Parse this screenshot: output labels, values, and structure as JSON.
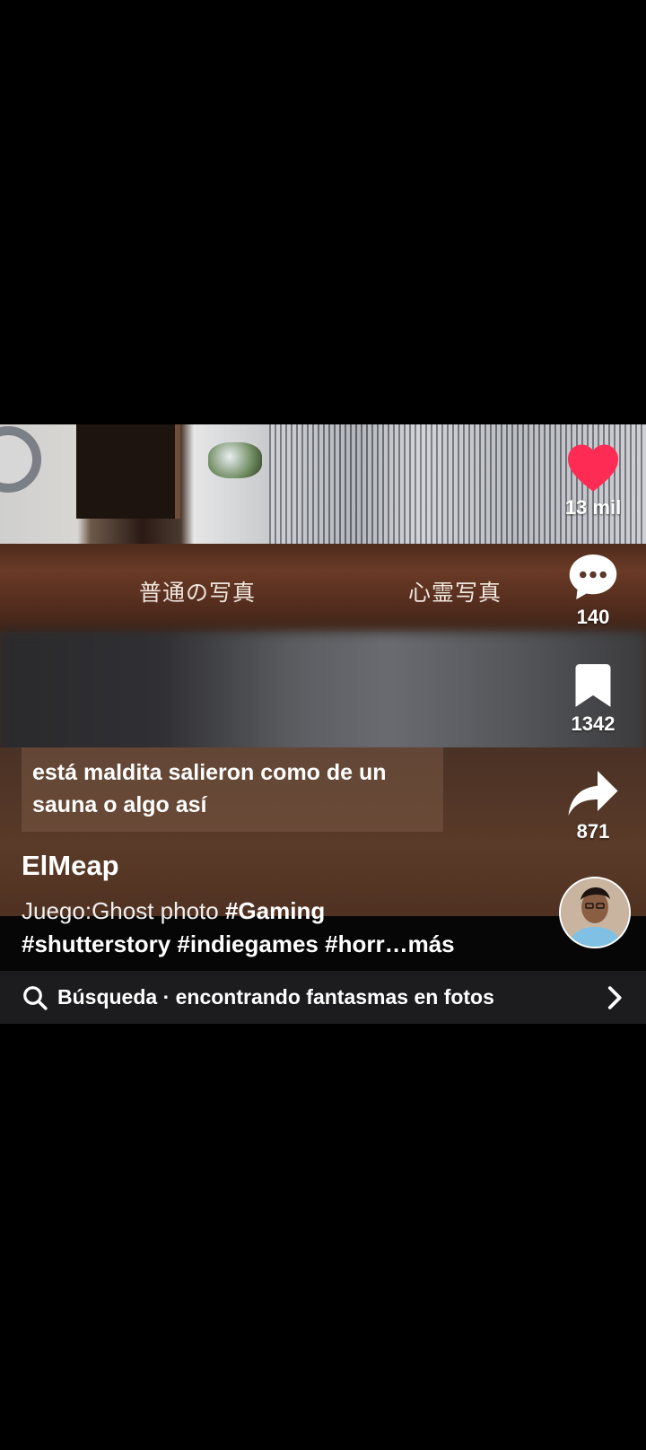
{
  "video": {
    "label_left": "普通の写真",
    "label_right": "心霊写真"
  },
  "caption": {
    "line1": "está maldita salieron como de un",
    "line2": "sauna o algo así"
  },
  "actions": {
    "likes": "13 mil",
    "comments": "140",
    "saves": "1342",
    "shares": "871",
    "like_color": "#fe2c55"
  },
  "post": {
    "username": "ElMeap",
    "desc_prefix": "Juego:Ghost photo ",
    "tag_gaming": "#Gaming",
    "desc_line2": "#shutterstory #indiegames #horr…",
    "more": "más"
  },
  "search": {
    "label": "Búsqueda · encontrando fantasmas en fotos"
  },
  "icons": [
    "heart-icon",
    "comment-icon",
    "bookmark-icon",
    "share-icon",
    "search-icon",
    "chevron-right-icon"
  ]
}
